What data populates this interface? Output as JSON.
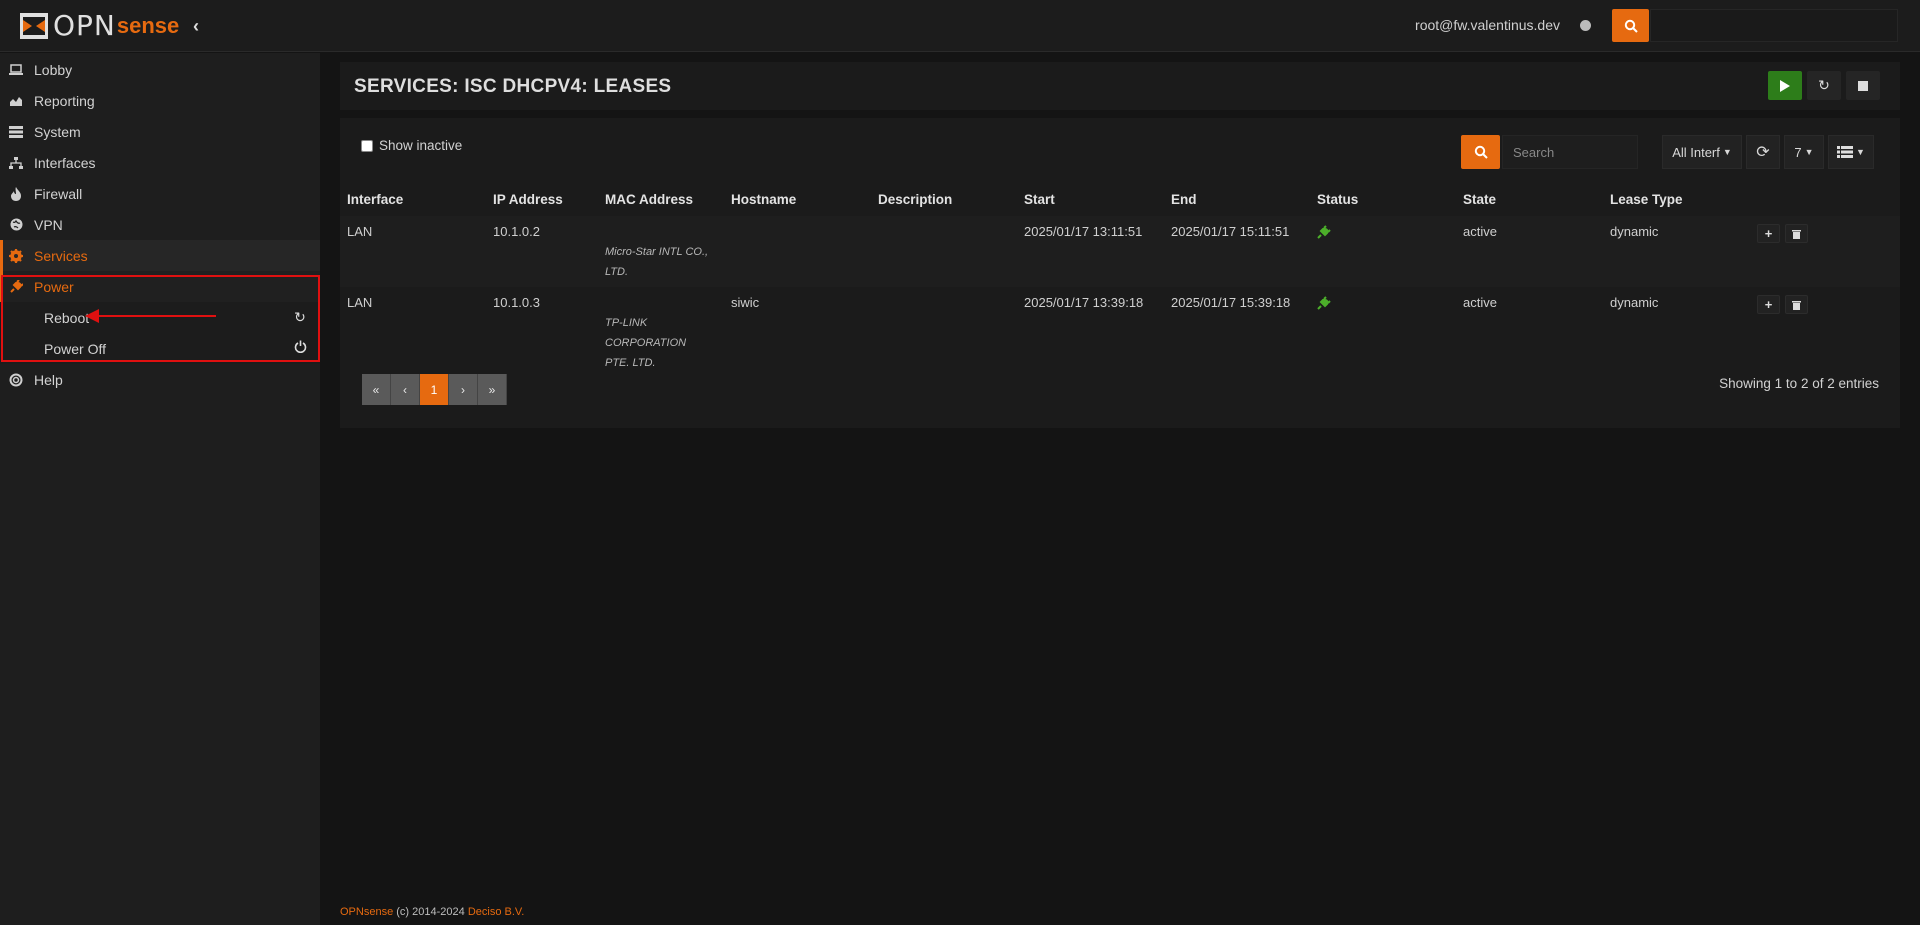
{
  "app": {
    "logo_text": "OPN",
    "logo_text2": "sense"
  },
  "topbar": {
    "user": "root@fw.valentinus.dev"
  },
  "sidebar": {
    "items": [
      {
        "label": "Lobby",
        "icon": "laptop-icon"
      },
      {
        "label": "Reporting",
        "icon": "area-chart-icon"
      },
      {
        "label": "System",
        "icon": "server-icon"
      },
      {
        "label": "Interfaces",
        "icon": "sitemap-icon"
      },
      {
        "label": "Firewall",
        "icon": "fire-icon"
      },
      {
        "label": "VPN",
        "icon": "globe-icon"
      },
      {
        "label": "Services",
        "icon": "gear-icon"
      },
      {
        "label": "Power",
        "icon": "plug-icon"
      },
      {
        "label": "Help",
        "icon": "lifebuoy-icon"
      }
    ],
    "power_sub": [
      {
        "label": "Reboot",
        "icon": "refresh-icon"
      },
      {
        "label": "Power Off",
        "icon": "power-icon"
      }
    ]
  },
  "page": {
    "title": "SERVICES: ISC DHCPV4: LEASES"
  },
  "grid": {
    "show_inactive_label": "Show inactive",
    "search_placeholder": "Search",
    "interface_filter": "All Interf",
    "page_size": "7",
    "columns": [
      "Interface",
      "IP Address",
      "MAC Address",
      "Hostname",
      "Description",
      "Start",
      "End",
      "Status",
      "State",
      "Lease Type"
    ],
    "rows": [
      {
        "interface": "LAN",
        "ip": "10.1.0.2",
        "vendor1": "Micro-Star INTL CO.,",
        "vendor2": "LTD.",
        "hostname": "",
        "description": "",
        "start": "2025/01/17 13:11:51",
        "end": "2025/01/17 15:11:51",
        "state": "active",
        "lease_type": "dynamic"
      },
      {
        "interface": "LAN",
        "ip": "10.1.0.3",
        "vendor1": "TP-LINK CORPORATION",
        "vendor2": "PTE. LTD.",
        "hostname": "siwic",
        "description": "",
        "start": "2025/01/17 13:39:18",
        "end": "2025/01/17 15:39:18",
        "state": "active",
        "lease_type": "dynamic"
      }
    ],
    "pager": {
      "first": "«",
      "prev": "‹",
      "current": "1",
      "next": "›",
      "last": "»"
    },
    "showing": "Showing 1 to 2 of 2 entries"
  },
  "footer": {
    "brand": "OPNsense",
    "copy": " (c) 2014-2024 ",
    "company": "Deciso B.V."
  },
  "colors": {
    "accent": "#e66a10",
    "success": "#2d7d1a",
    "highlight": "#e01010"
  }
}
